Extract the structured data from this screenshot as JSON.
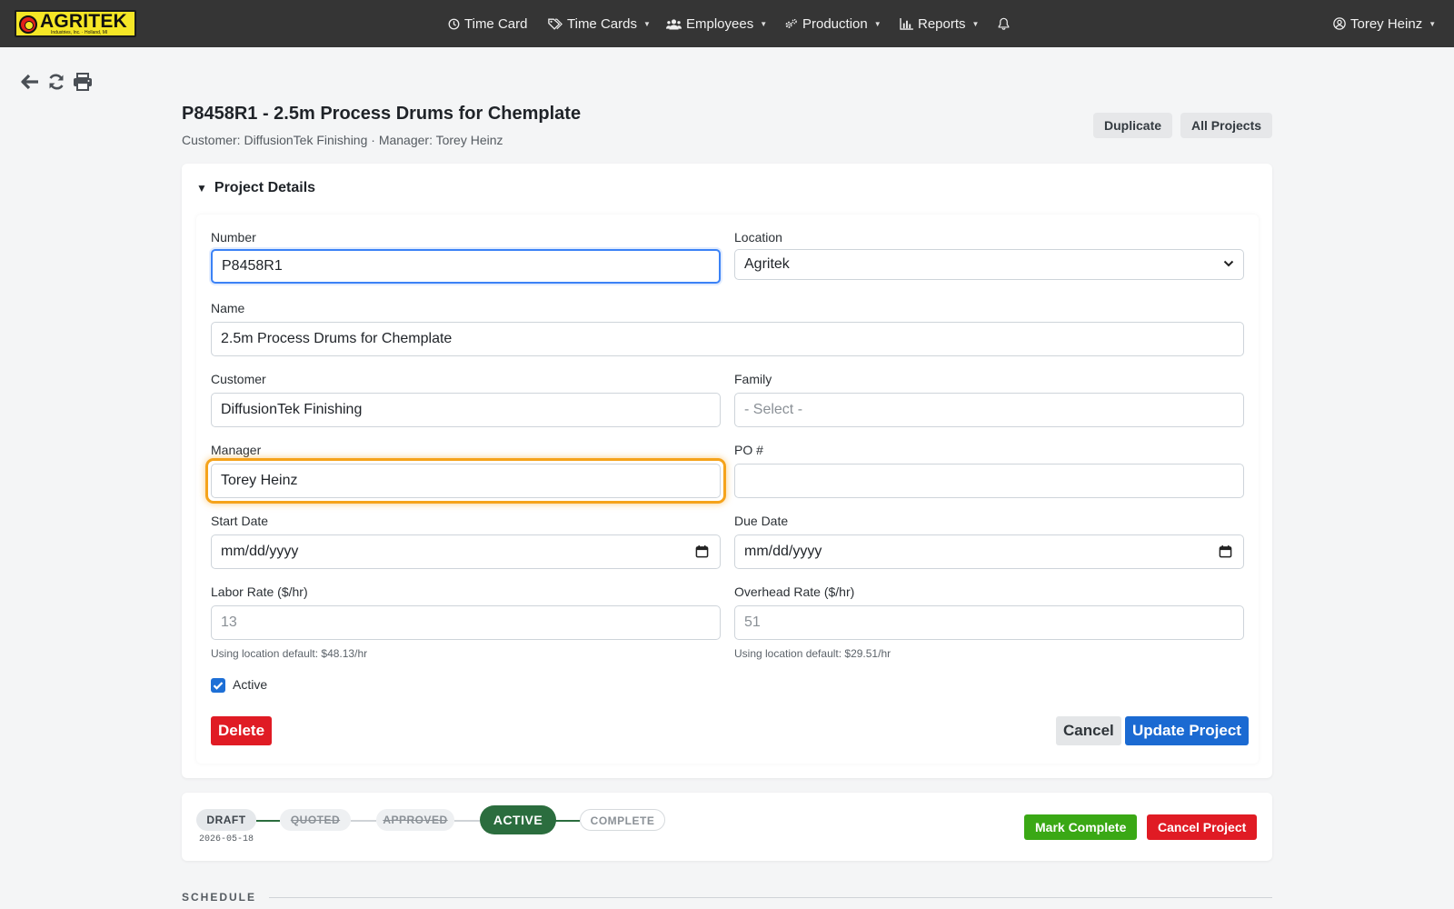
{
  "brand": {
    "logo_text": "AGRITEK",
    "logo_subtext": "Industries, Inc. · Holland, MI",
    "logo_colors": {
      "background": "#f5e626",
      "mark": "#e2231a"
    }
  },
  "nav": {
    "items": [
      {
        "label": "Time Card",
        "icon": "clock-icon",
        "has_caret": false
      },
      {
        "label": "Time Cards",
        "icon": "tags-icon",
        "has_caret": true
      },
      {
        "label": "Employees",
        "icon": "users-icon",
        "has_caret": true
      },
      {
        "label": "Production",
        "icon": "gears-icon",
        "has_caret": true
      },
      {
        "label": "Reports",
        "icon": "bar-chart-icon",
        "has_caret": true
      }
    ],
    "notifications_icon": "bell-icon",
    "user": {
      "name": "Torey Heinz",
      "icon": "user-circle-icon"
    }
  },
  "toolbar": {
    "icons": [
      "back-arrow-icon",
      "refresh-icon",
      "print-icon"
    ]
  },
  "header": {
    "title": "P8458R1 - 2.5m Process Drums for Chemplate",
    "subtitle": "Customer: DiffusionTek Finishing · Manager: Torey Heinz",
    "duplicate_label": "Duplicate",
    "all_projects_label": "All Projects"
  },
  "details": {
    "summary_label": "Project Details",
    "number": {
      "label": "Number",
      "value": "P8458R1"
    },
    "location": {
      "label": "Location",
      "value": "Agritek"
    },
    "name": {
      "label": "Name",
      "value": "2.5m Process Drums for Chemplate"
    },
    "customer": {
      "label": "Customer",
      "value": "DiffusionTek Finishing"
    },
    "family": {
      "label": "Family",
      "placeholder": "- Select -"
    },
    "manager": {
      "label": "Manager",
      "value": "Torey Heinz"
    },
    "po": {
      "label": "PO #",
      "value": ""
    },
    "start_date": {
      "label": "Start Date",
      "placeholder": "mm/dd/yyyy"
    },
    "due_date": {
      "label": "Due Date",
      "placeholder": "mm/dd/yyyy"
    },
    "labor_rate": {
      "label": "Labor Rate ($/hr)",
      "placeholder": "13",
      "help": "Using location default: $48.13/hr"
    },
    "overhead_rate": {
      "label": "Overhead Rate ($/hr)",
      "placeholder": "51",
      "help": "Using location default: $29.51/hr"
    },
    "active": {
      "label": "Active",
      "checked": true
    },
    "delete_label": "Delete",
    "cancel_label": "Cancel",
    "update_label": "Update Project"
  },
  "workflow": {
    "stages": [
      {
        "label": "DRAFT",
        "state": "done",
        "date": "2026-05-18"
      },
      {
        "label": "QUOTED",
        "state": "skipped"
      },
      {
        "label": "APPROVED",
        "state": "skipped"
      },
      {
        "label": "ACTIVE",
        "state": "current"
      },
      {
        "label": "COMPLETE",
        "state": "pending"
      }
    ],
    "mark_complete_label": "Mark Complete",
    "cancel_project_label": "Cancel Project",
    "colors": {
      "active": "#2b6d3e",
      "mark_complete": "#3aa815",
      "cancel_project": "#e01b24"
    }
  },
  "schedule": {
    "label": "SCHEDULE"
  }
}
